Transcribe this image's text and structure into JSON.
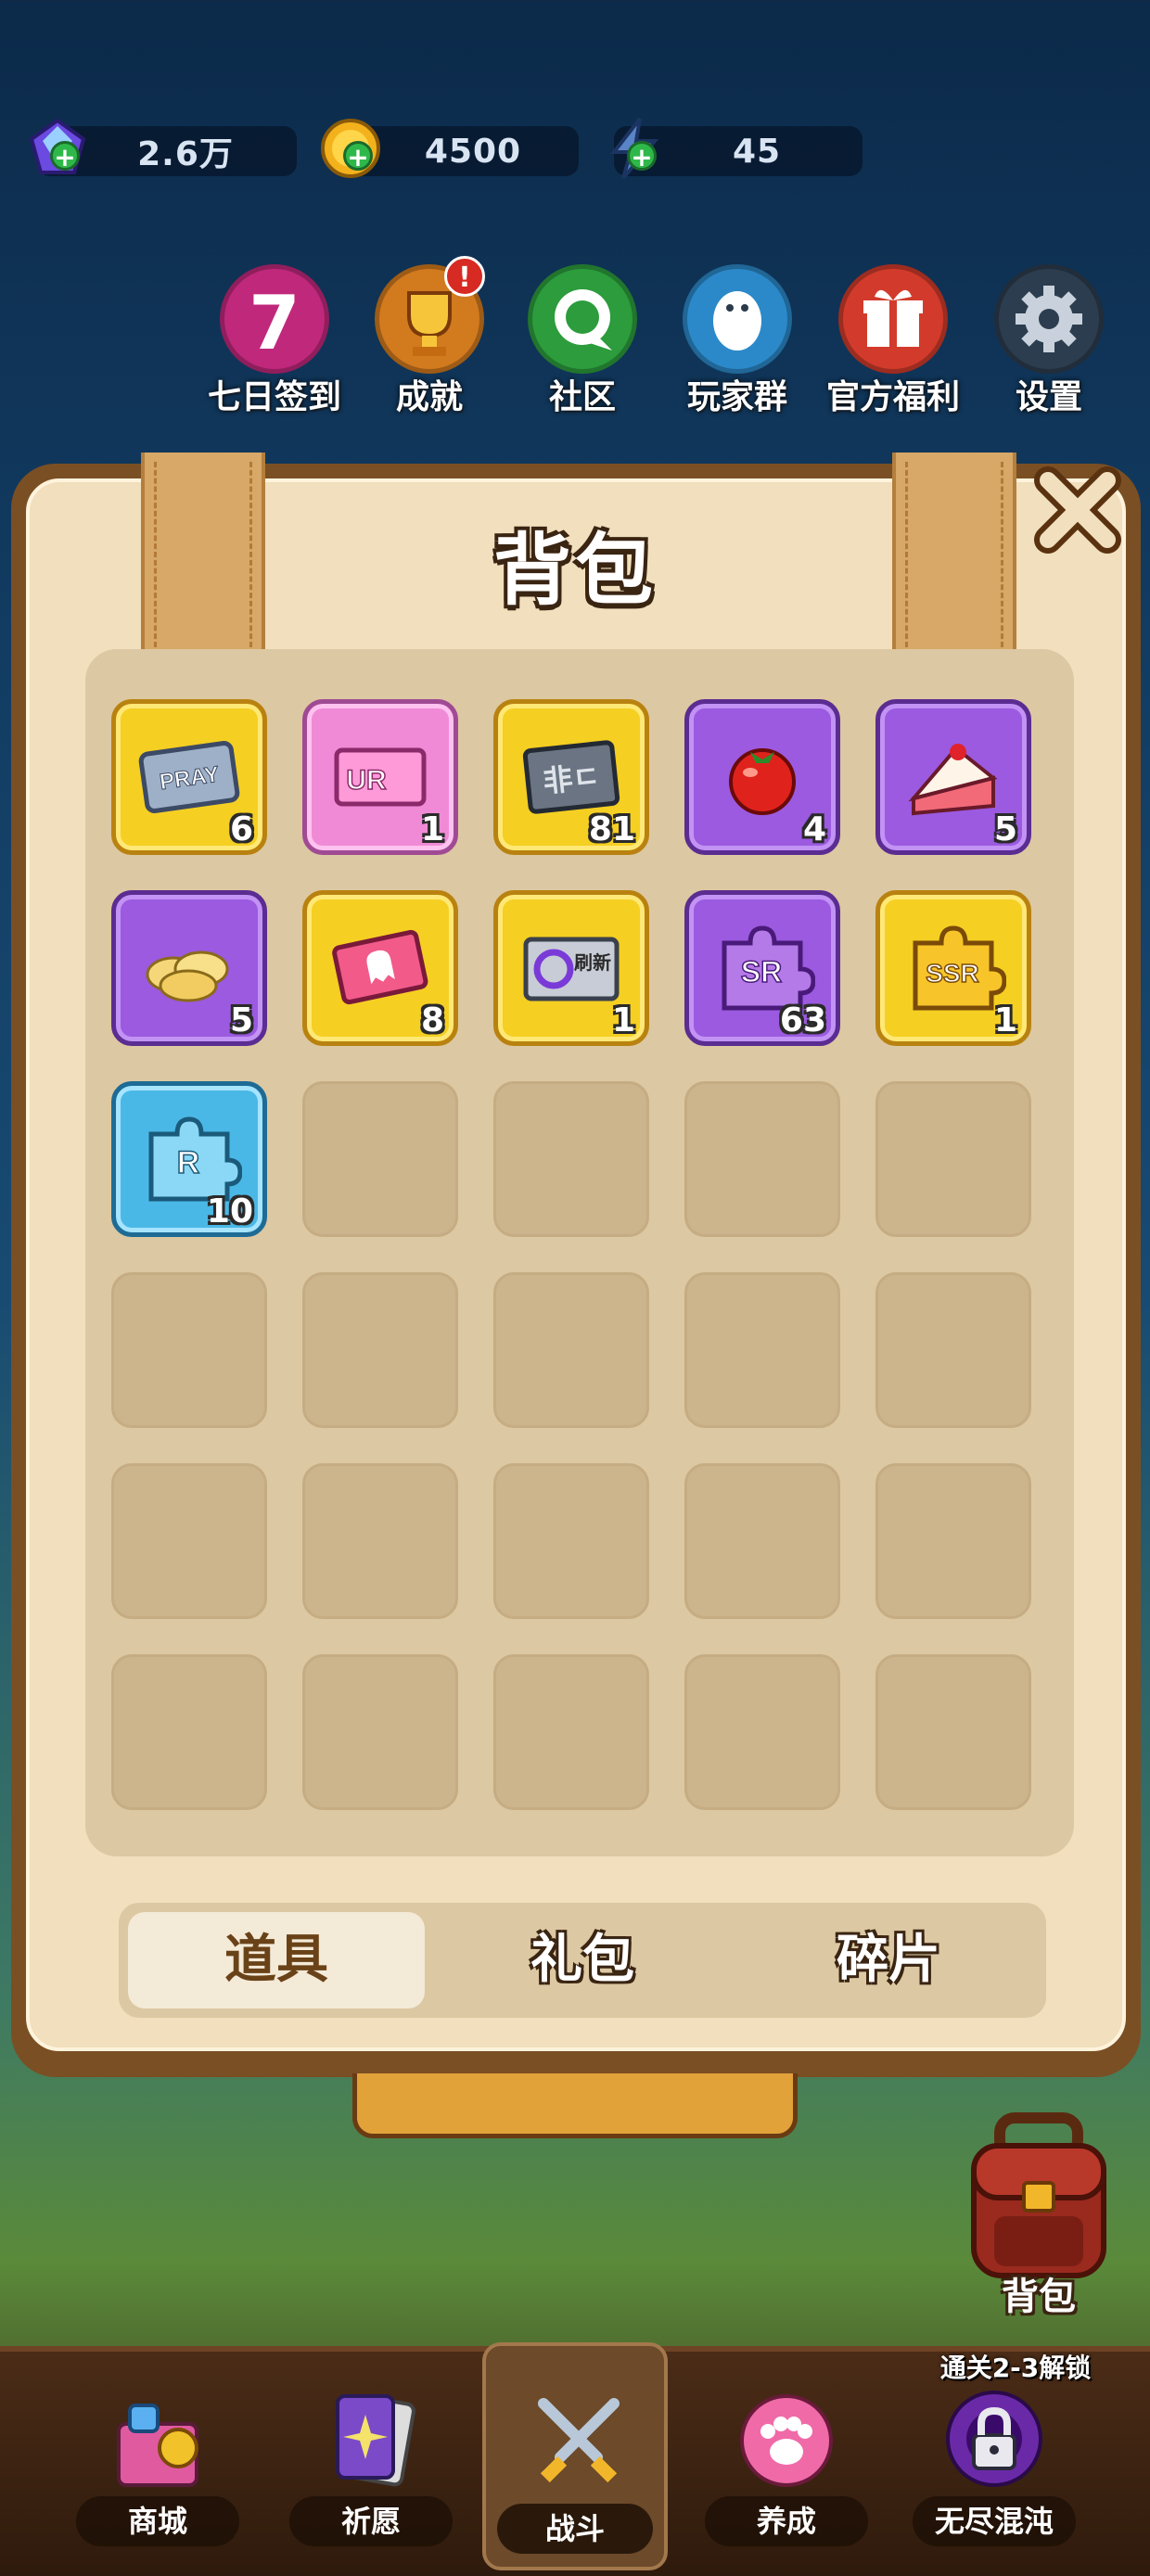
{
  "currencies": [
    {
      "icon": "gem-icon",
      "value": "2.6万"
    },
    {
      "icon": "gold-coin-icon",
      "value": "4500"
    },
    {
      "icon": "energy-bolt-icon",
      "value": "45"
    }
  ],
  "menu": [
    {
      "name": "seven-day-signin",
      "label": "七日签到",
      "icon_glyph": "7",
      "color": "#c0287c"
    },
    {
      "name": "achievements",
      "label": "成就",
      "icon_glyph": "★",
      "color": "#d27a1e",
      "badge": "!"
    },
    {
      "name": "community",
      "label": "社区",
      "icon_glyph": "◉",
      "color": "#2c9c3c"
    },
    {
      "name": "player-group",
      "label": "玩家群",
      "icon_glyph": "☺",
      "color": "#2b89c9"
    },
    {
      "name": "official-welfare",
      "label": "官方福利",
      "icon_glyph": "▣",
      "color": "#d23b2b"
    },
    {
      "name": "settings",
      "label": "设置",
      "icon_glyph": "⚙",
      "color": "#2c3d4f"
    }
  ],
  "panel": {
    "title": "背包"
  },
  "items": [
    {
      "name": "pray-ticket",
      "frame": "gold",
      "label": "PRAY",
      "qty": "6"
    },
    {
      "name": "ur-ticket",
      "frame": "pink",
      "label": "UR",
      "qty": "1"
    },
    {
      "name": "fei-ticket",
      "frame": "gold",
      "label": "非ㄷ",
      "qty": "81"
    },
    {
      "name": "tomato",
      "frame": "purple",
      "label": "",
      "qty": "4"
    },
    {
      "name": "cake",
      "frame": "purple",
      "label": "",
      "qty": "5"
    },
    {
      "name": "chips",
      "frame": "purple",
      "label": "",
      "qty": "5"
    },
    {
      "name": "ghost-ticket",
      "frame": "gold",
      "label": "",
      "qty": "8"
    },
    {
      "name": "refresh-ticket",
      "frame": "gold",
      "label": "刷新",
      "qty": "1"
    },
    {
      "name": "sr-fragment",
      "frame": "purple",
      "label": "SR",
      "qty": "63"
    },
    {
      "name": "ssr-fragment",
      "frame": "gold",
      "label": "SSR",
      "qty": "1"
    },
    {
      "name": "r-fragment",
      "frame": "blue",
      "label": "R",
      "qty": "10"
    }
  ],
  "tabs": [
    {
      "label": "道具",
      "active": true
    },
    {
      "label": "礼包",
      "active": false
    },
    {
      "label": "碎片",
      "active": false
    }
  ],
  "backpack_button": {
    "label": "背包"
  },
  "bottom_nav": [
    {
      "name": "shop",
      "label": "商城",
      "color": "#e05aa0"
    },
    {
      "name": "wish",
      "label": "祈愿",
      "color": "#7a4ac9"
    },
    {
      "name": "battle",
      "label": "战斗",
      "color": "#8aa4b8",
      "active": true
    },
    {
      "name": "nurture",
      "label": "养成",
      "color": "#f06aa8"
    },
    {
      "name": "endless-chaos",
      "label": "无尽混沌",
      "color": "#6a2aa8"
    }
  ],
  "unlock_note": "通关2-3解锁"
}
